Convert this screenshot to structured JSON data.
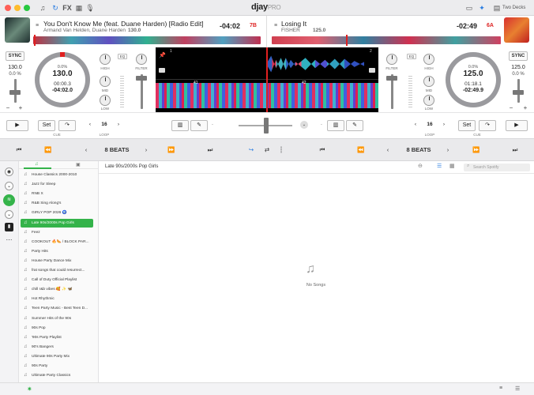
{
  "app": {
    "name": "djay",
    "name_suffix": "PRO",
    "mode_label": "Two Decks",
    "fx_label": "FX"
  },
  "colors": {
    "accent_red": "#e02020",
    "accent_green": "#34b34a",
    "accent_blue": "#2a7de1"
  },
  "deck_left": {
    "title": "You Don't Know Me (feat. Duane Harden) [Radio Edit]",
    "artist": "Armand Van Helden, Duane Harden",
    "bpm_header": "130.0",
    "time_remaining": "-04:02",
    "key": "7B",
    "sync_label": "SYNC",
    "tempo": "130.0",
    "tempo_pct": "0.0 %",
    "jog_pct": "0.0%",
    "jog_bpm": "130.0",
    "elapsed": "00:00.3",
    "remaining": "-04:02.0",
    "cue_label": "Set",
    "cue_caption": "CUE",
    "loop_value": "16",
    "loop_caption": "LOOP",
    "beats_label": "8 BEATS",
    "eq_label": "EQ",
    "high_label": "HIGH",
    "mid_label": "MID",
    "low_label": "LOW",
    "filter_label": "FILTER"
  },
  "deck_right": {
    "title": "Losing It",
    "artist": "FISHER",
    "bpm_header": "125.0",
    "time_remaining": "-02:49",
    "key": "6A",
    "sync_label": "SYNC",
    "tempo": "125.0",
    "tempo_pct": "0.0 %",
    "jog_pct": "0.0%",
    "jog_bpm": "125.0",
    "elapsed": "01:18.1",
    "remaining": "-02:49.9",
    "cue_label": "Set",
    "cue_caption": "CUE",
    "loop_value": "16",
    "loop_caption": "LOOP",
    "beats_label": "8 BEATS",
    "eq_label": "EQ",
    "high_label": "HIGH",
    "mid_label": "MID",
    "low_label": "LOW",
    "filter_label": "FILTER"
  },
  "waveform": {
    "left_marker": "1",
    "right_marker": "2",
    "bar_left": "41",
    "bar_right": "42"
  },
  "library": {
    "breadcrumb": "Late 90s/2000s Pop Girls",
    "search_placeholder": "Search Spotify",
    "empty_text": "No Songs",
    "playlists": [
      "House Classics 2000-2010",
      "Jazz for Sleep",
      "RNB X",
      "R&B Sing Along's",
      "GIRLY POP 2026 🧿",
      "Late 90s/2000s Pop Girls",
      "Feez",
      "COOKOUT 🔥🌭 / BLOCK PAR...",
      "Party Hits",
      "House Party Dance Mix",
      "frat songs that could resurrect...",
      "Call of Duty Official Playlist",
      "chill r&b vibes 🥰 ✨ 🦋",
      "Hot Rhythmic",
      "Teen Party Music - Best Teen D...",
      "Summer Hits of the 90s",
      "90s Pop",
      "'90s Party Playlist",
      "90's Bangers",
      "Ultimate 90s Party Mix",
      "90s Party",
      "Ultimate Party Classics"
    ],
    "selected_index": 5
  }
}
